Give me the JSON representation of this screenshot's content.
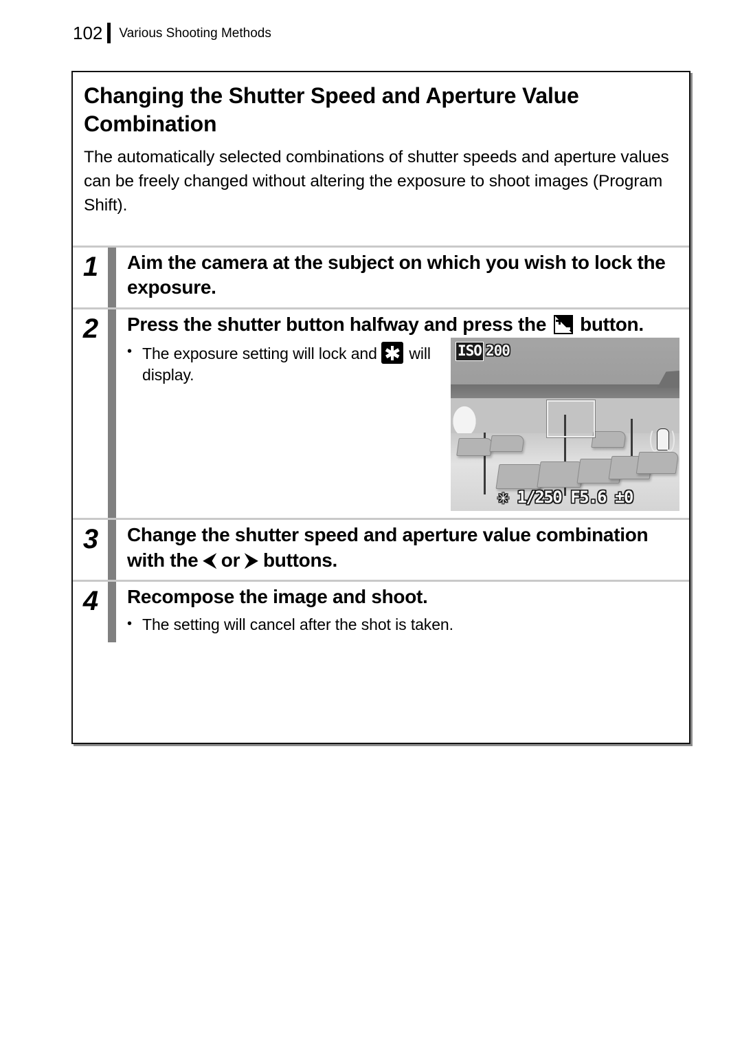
{
  "header": {
    "page_number": "102",
    "title": "Various Shooting Methods"
  },
  "section": {
    "title": "Changing the Shutter Speed and Aperture Value Combination",
    "intro": "The automatically selected combinations of shutter speeds and aperture values can be freely changed without altering the exposure to shoot images (Program Shift)."
  },
  "steps": [
    {
      "number": "1",
      "heading": "Aim the camera at the subject on which you wish to lock the exposure."
    },
    {
      "number": "2",
      "heading_before_icon": "Press the shutter button halfway and press the ",
      "icon": "exposure-compensation-icon",
      "heading_after_icon": " button.",
      "note_bullet": "•",
      "note_before_icon": "The exposure setting will lock and ",
      "note_icon": "ae-lock-asterisk-icon",
      "note_after_icon": " will display."
    },
    {
      "number": "3",
      "heading_part1": "Change the shutter speed and aperture value combination with the ",
      "arrow_left": "⮜",
      "heading_part2": " or ",
      "arrow_right": "⮞",
      "heading_part3": " buttons."
    },
    {
      "number": "4",
      "heading": "Recompose the image and shoot.",
      "note_bullet": "•",
      "note": "The setting will cancel after the shot is taken."
    }
  ],
  "lcd_screen": {
    "iso_label": "ISO",
    "iso_value": "200",
    "shake_warning_icon": "camera-shake-warning-icon",
    "af_frame": "af-frame",
    "status": {
      "ae_lock_symbol": "✳",
      "shutter_speed": "1/250",
      "aperture": "F5.6",
      "exposure_compensation": "±0"
    }
  },
  "colors": {
    "step_bar_gray": "#808080",
    "separator_gray": "#c9c9c9",
    "box_border": "#111111"
  }
}
